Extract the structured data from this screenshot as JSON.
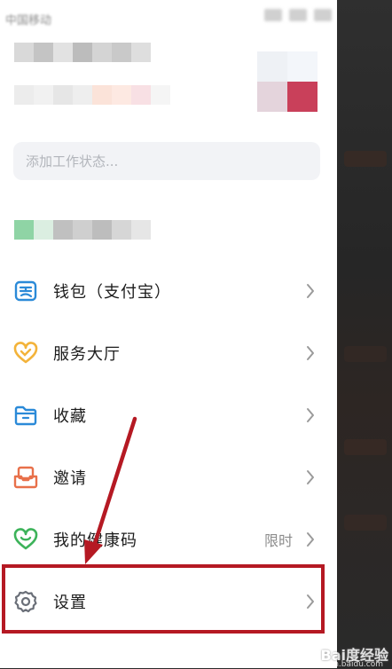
{
  "status_bar": {
    "carrier": "中国移动"
  },
  "status_input": {
    "placeholder": "添加工作状态..."
  },
  "menu": {
    "items": [
      {
        "label": "钱包（支付宝）",
        "icon": "wallet-icon",
        "color": "#2b8ad8"
      },
      {
        "label": "服务大厅",
        "icon": "heart-service-icon",
        "color": "#f3b33a"
      },
      {
        "label": "收藏",
        "icon": "folder-icon",
        "color": "#2b8ad8"
      },
      {
        "label": "邀请",
        "icon": "invite-tray-icon",
        "color": "#e8704a"
      },
      {
        "label": "我的健康码",
        "icon": "health-code-icon",
        "color": "#3db35a",
        "trail": "限时"
      },
      {
        "label": "设置",
        "icon": "gear-icon",
        "color": "#6a6f78"
      }
    ]
  },
  "annotation": {
    "arrow_color": "#b51923",
    "box_color": "#b51923"
  },
  "watermark": {
    "brand": "Bai度经验",
    "sub": "jingyan.baidu.com"
  }
}
